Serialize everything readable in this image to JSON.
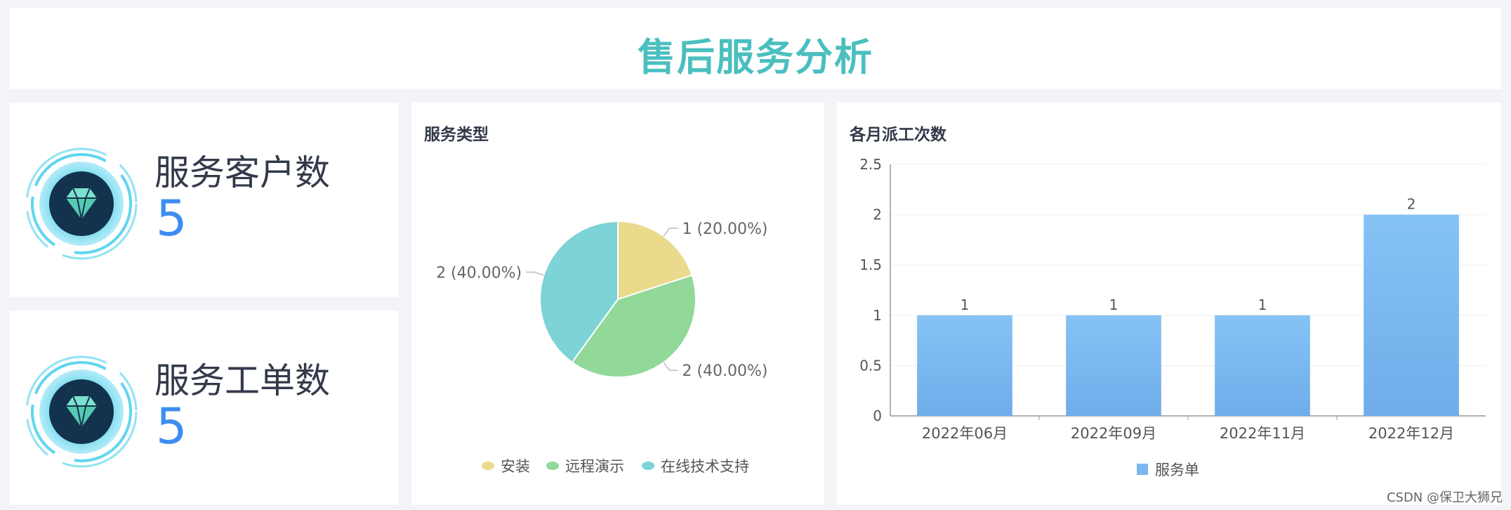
{
  "header": {
    "title": "售后服务分析"
  },
  "kpis": [
    {
      "label": "服务客户数",
      "value": "5",
      "icon": "diamond-icon"
    },
    {
      "label": "服务工单数",
      "value": "5",
      "icon": "diamond-icon"
    }
  ],
  "colors": {
    "title": "#4bbfbf",
    "kpi_value": "#3f8cf0",
    "pie": [
      "#e9da8c",
      "#91d899",
      "#7dd3d6"
    ],
    "bar": "#7ab7ee"
  },
  "pie_chart": {
    "title": "服务类型",
    "legend_position": "bottom",
    "slices": [
      {
        "name": "安装",
        "value": 1,
        "label": "1 (20.00%)"
      },
      {
        "name": "远程演示",
        "value": 2,
        "label": "2 (40.00%)"
      },
      {
        "name": "在线技术支持",
        "value": 2,
        "label": "2 (40.00%)"
      }
    ]
  },
  "chart_data": {
    "type": "bar",
    "title": "各月派工次数",
    "categories": [
      "2022年06月",
      "2022年09月",
      "2022年11月",
      "2022年12月"
    ],
    "series": [
      {
        "name": "服务单",
        "values": [
          1,
          1,
          1,
          2
        ]
      }
    ],
    "yticks": [
      "0",
      "0.5",
      "1",
      "1.5",
      "2",
      "2.5"
    ],
    "ylim": [
      0,
      2.5
    ],
    "data_labels": [
      "1",
      "1",
      "1",
      "2"
    ],
    "grid": true,
    "legend_position": "bottom"
  },
  "watermark": "CSDN @保卫大狮兄"
}
